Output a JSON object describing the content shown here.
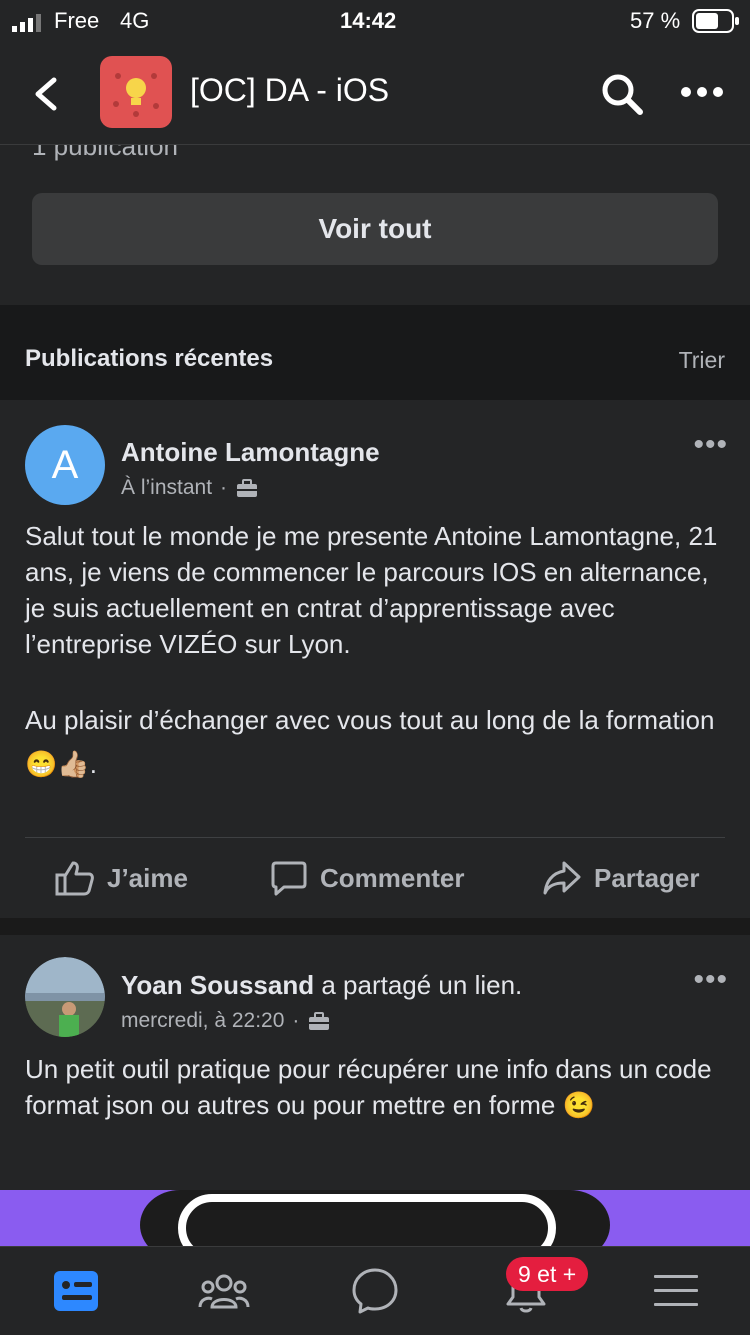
{
  "status_bar": {
    "carrier": "Free",
    "network": "4G",
    "time": "14:42",
    "battery": "57 %"
  },
  "header": {
    "back_icon": "chevron-left-icon",
    "title": "[OC] DA - iOS",
    "search_icon": "search-icon",
    "more_icon": "more-icon"
  },
  "summary": {
    "publication_count": "1 publication",
    "see_all_label": "Voir tout"
  },
  "recent": {
    "title": "Publications récentes",
    "sort_label": "Trier"
  },
  "posts": [
    {
      "avatar_letter": "A",
      "author": "Antoine Lamontagne",
      "timestamp": "À l’instant",
      "body_p1": "Salut tout le monde je me presente Antoine Lamontagne, 21 ans, je viens de commencer le parcours IOS en alternance, je suis actuellement en cntrat d’apprentissage avec l’entreprise VIZÉO sur Lyon.",
      "body_p2": "Au plaisir d’échanger avec vous tout au long de la formation 😁👍🏼.",
      "actions": {
        "like": "J’aime",
        "comment": "Commenter",
        "share": "Partager"
      }
    },
    {
      "author": "Yoan Soussand",
      "author_suffix": "a partagé un lien.",
      "timestamp": "mercredi, à 22:20",
      "body": "Un petit outil pratique pour récupérer une info dans un code format json ou autres ou pour mettre en forme 😉"
    }
  ],
  "tabbar": {
    "notification_badge": "9 et +",
    "tabs": [
      "feed-icon",
      "groups-icon",
      "messenger-icon",
      "bell-icon",
      "menu-icon"
    ]
  },
  "colors": {
    "surface": "#242526",
    "background": "#18191a",
    "accent_blue": "#2d88ff",
    "badge_red": "#e41e3f",
    "group_icon_red": "#e05252"
  }
}
